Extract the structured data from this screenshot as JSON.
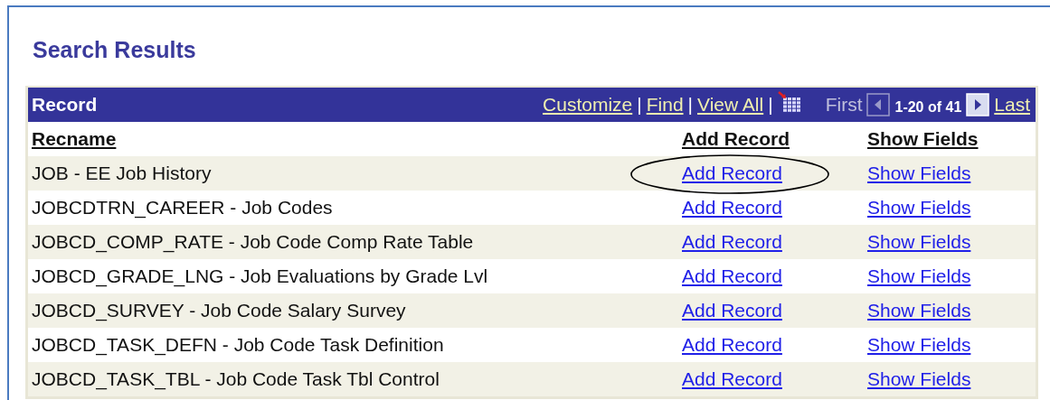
{
  "page_title": "Search Results",
  "grid": {
    "title": "Record",
    "separator": "|",
    "links": [
      "Customize",
      "Find",
      "View All"
    ],
    "first": "First",
    "range": "1-20 of 41",
    "last": "Last",
    "prev_disabled": true,
    "next_disabled": false
  },
  "columns": [
    "Recname",
    "Add Record",
    "Show Fields"
  ],
  "rows": [
    {
      "recname": "JOB - EE Job History",
      "add": "Add Record",
      "show": "Show Fields",
      "circled": true
    },
    {
      "recname": "JOBCDTRN_CAREER - Job Codes",
      "add": "Add Record",
      "show": "Show Fields",
      "circled": false
    },
    {
      "recname": "JOBCD_COMP_RATE - Job Code Comp Rate Table",
      "add": "Add Record",
      "show": "Show Fields",
      "circled": false
    },
    {
      "recname": "JOBCD_GRADE_LNG - Job Evaluations by Grade Lvl",
      "add": "Add Record",
      "show": "Show Fields",
      "circled": false
    },
    {
      "recname": "JOBCD_SURVEY - Job Code Salary Survey",
      "add": "Add Record",
      "show": "Show Fields",
      "circled": false
    },
    {
      "recname": "JOBCD_TASK_DEFN - Job Code Task Definition",
      "add": "Add Record",
      "show": "Show Fields",
      "circled": false
    },
    {
      "recname": "JOBCD_TASK_TBL - Job Code Task Tbl Control",
      "add": "Add Record",
      "show": "Show Fields",
      "circled": false
    }
  ]
}
